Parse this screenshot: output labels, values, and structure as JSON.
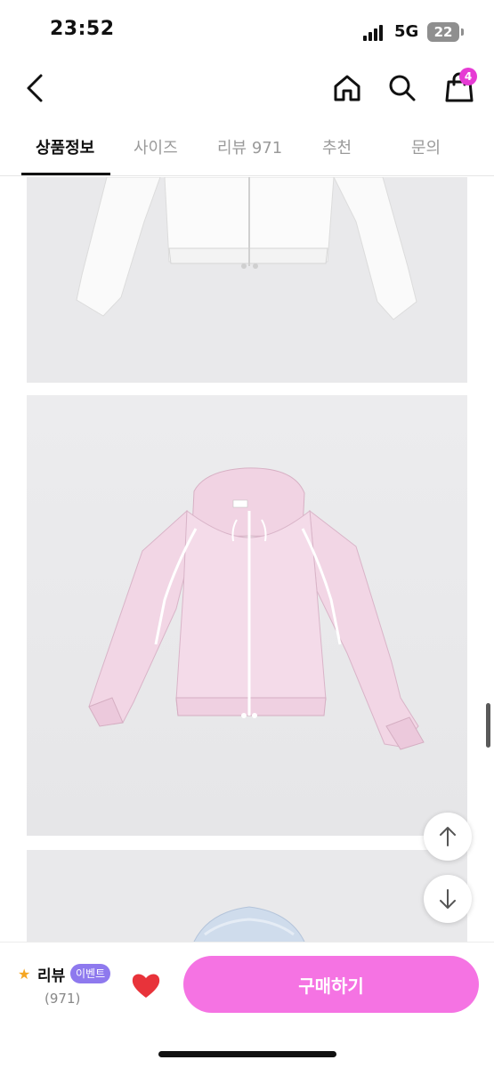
{
  "status_bar": {
    "time": "23:52",
    "network": "5G",
    "battery": "22"
  },
  "header": {
    "cart_count": "4",
    "icons": [
      "chevron-left-icon",
      "home-icon",
      "search-icon",
      "shopping-bag-icon"
    ]
  },
  "tabs": [
    {
      "label": "상품정보",
      "active": true
    },
    {
      "label": "사이즈",
      "active": false
    },
    {
      "label": "리뷰 971",
      "active": false
    },
    {
      "label": "추천",
      "active": false
    },
    {
      "label": "문의",
      "active": false
    }
  ],
  "bottom_bar": {
    "review_label": "리뷰",
    "event_badge": "이벤트",
    "review_count": "(971)",
    "buy_label": "구매하기"
  },
  "colors": {
    "accent": "#f573e3",
    "badge": "#e63bd4",
    "event": "#8e79ee",
    "heart": "#e8333a",
    "star": "#f5a623"
  }
}
